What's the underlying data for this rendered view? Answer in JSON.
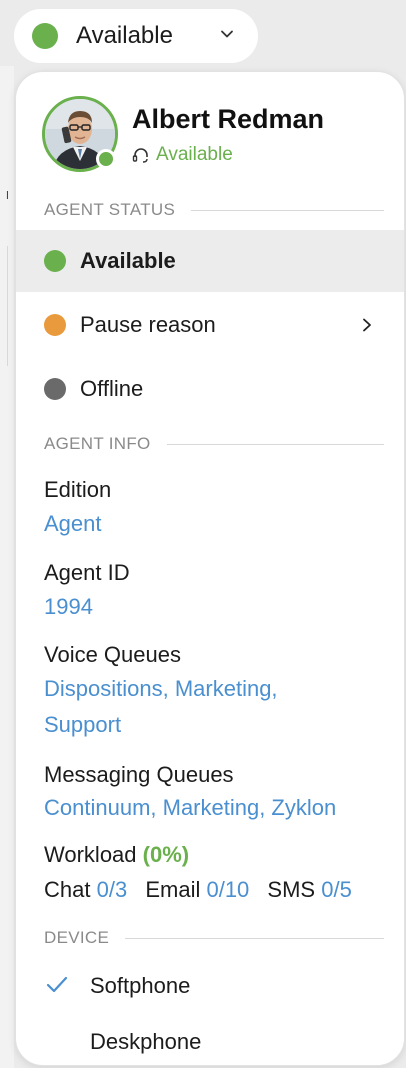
{
  "status_button": {
    "label": "Available"
  },
  "profile": {
    "name": "Albert Redman",
    "status": "Available"
  },
  "sections": {
    "agent_status": "AGENT STATUS",
    "agent_info": "AGENT INFO",
    "device": "DEVICE"
  },
  "statuses": [
    {
      "label": "Available",
      "color": "#6ab04c",
      "selected": true
    },
    {
      "label": "Pause reason",
      "color": "#e99a3c",
      "has_submenu": true
    },
    {
      "label": "Offline",
      "color": "#6a6a6a"
    }
  ],
  "info": {
    "edition_label": "Edition",
    "edition_value": "Agent",
    "agent_id_label": "Agent ID",
    "agent_id_value": "1994",
    "voice_queues_label": "Voice Queues",
    "voice_queues_line1": "Dispositions, Marketing,",
    "voice_queues_line2": "Support",
    "messaging_queues_label": "Messaging Queues",
    "messaging_queues_value": "Continuum, Marketing, Zyklon",
    "workload_label": "Workload",
    "workload_pct": "(0%)",
    "chat_label": "Chat",
    "chat_value": "0/3",
    "email_label": "Email",
    "email_value": "0/10",
    "sms_label": "SMS",
    "sms_value": "0/5"
  },
  "devices": [
    {
      "label": "Softphone",
      "checked": true
    },
    {
      "label": "Deskphone",
      "checked": false
    }
  ],
  "colors": {
    "accent_green": "#6ab04c",
    "accent_orange": "#e99a3c",
    "offline_gray": "#6a6a6a",
    "link_blue": "#4a8fcf"
  }
}
